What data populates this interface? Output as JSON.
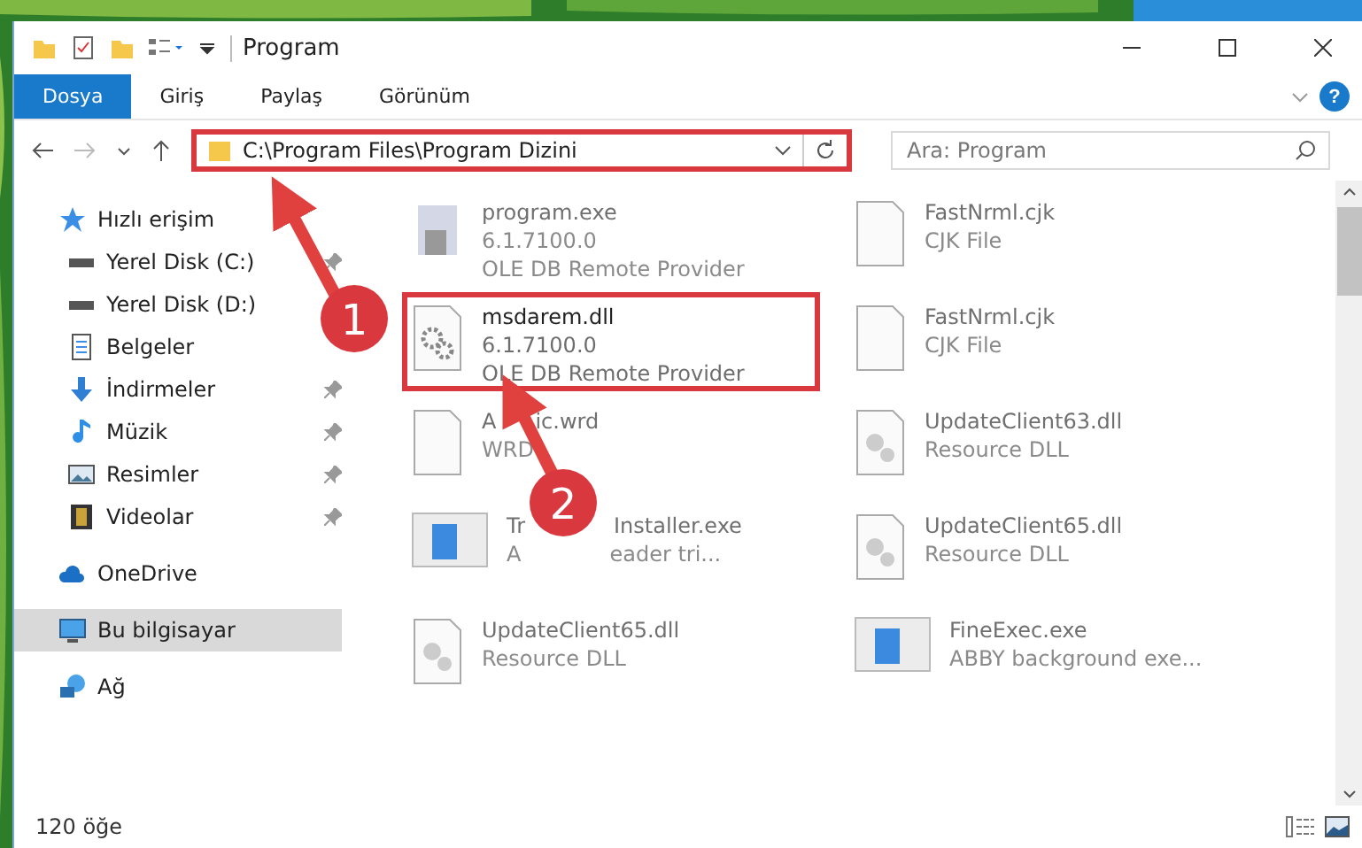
{
  "window": {
    "title": "Program"
  },
  "ribbon_tabs": [
    {
      "label": "Dosya",
      "selected": true
    },
    {
      "label": "Giriş",
      "selected": false
    },
    {
      "label": "Paylaş",
      "selected": false
    },
    {
      "label": "Görünüm",
      "selected": false
    }
  ],
  "help": "?",
  "address": {
    "value": "C:\\Program Files\\Program Dizini",
    "highlighted": true
  },
  "search": {
    "placeholder": "Ara: Program"
  },
  "sidebar": {
    "items": [
      {
        "label": "Hızlı erişim",
        "kind": "star",
        "selected": false,
        "children": [
          {
            "label": "Yerel Disk (C:)",
            "kind": "drive",
            "pinned": true,
            "selected": false
          },
          {
            "label": "Yerel Disk (D:)",
            "kind": "drive",
            "pinned": false,
            "selected": false
          },
          {
            "label": "Belgeler",
            "kind": "document",
            "pinned": false,
            "selected": false
          },
          {
            "label": "İndirmeler",
            "kind": "download",
            "pinned": true,
            "selected": false
          },
          {
            "label": "Müzik",
            "kind": "music",
            "pinned": true,
            "selected": false
          },
          {
            "label": "Resimler",
            "kind": "pictures",
            "pinned": true,
            "selected": false
          },
          {
            "label": "Videolar",
            "kind": "video",
            "pinned": true,
            "selected": false
          }
        ]
      },
      {
        "label": "OneDrive",
        "kind": "cloud",
        "selected": false
      },
      {
        "label": "Bu bilgisayar",
        "kind": "computer",
        "selected": true
      },
      {
        "label": "Ağ",
        "kind": "network",
        "selected": false
      }
    ]
  },
  "files": [
    {
      "name": [
        "program.exe"
      ],
      "lines": [
        [
          "6.1.7100.0"
        ],
        [
          "OLE DB Remote Provider"
        ]
      ],
      "kind": "exe",
      "highlighted": false
    },
    {
      "name": [
        "FastNrml.cjk"
      ],
      "lines": [
        [
          "CJK File"
        ]
      ],
      "kind": "blank",
      "highlighted": false
    },
    {
      "name": [
        "msdarem.dll"
      ],
      "lines": [
        [
          "6.1.7100.0"
        ],
        [
          "OLE DB Remote Provider"
        ]
      ],
      "kind": "dll",
      "highlighted": true
    },
    {
      "name": [
        "FastNrml.cjk"
      ],
      "lines": [
        [
          "CJK File"
        ]
      ],
      "kind": "blank",
      "highlighted": false
    },
    {
      "name": [
        "A",
        "ic.wrd"
      ],
      "lines": [
        [
          "WRD"
        ]
      ],
      "kind": "blank",
      "highlighted": false
    },
    {
      "name": [
        "UpdateClient63.dll"
      ],
      "lines": [
        [
          "Resource DLL"
        ]
      ],
      "kind": "resource",
      "highlighted": false
    },
    {
      "name": [
        "Tr",
        "Installer.exe"
      ],
      "lines": [
        [
          "A",
          "eader tri..."
        ]
      ],
      "kind": "app",
      "highlighted": false
    },
    {
      "name": [
        "UpdateClient65.dll"
      ],
      "lines": [
        [
          "Resource DLL"
        ]
      ],
      "kind": "resource",
      "highlighted": false
    },
    {
      "name": [
        "UpdateClient65.dll"
      ],
      "lines": [
        [
          "Resource DLL"
        ]
      ],
      "kind": "resource",
      "highlighted": false
    },
    {
      "name": [
        "FineExec.exe"
      ],
      "lines": [
        [
          "ABBY background exe..."
        ]
      ],
      "kind": "app",
      "highlighted": false
    }
  ],
  "status_bar": {
    "count": "120 öğe"
  },
  "annotations": [
    {
      "label": "1"
    },
    {
      "label": "2"
    }
  ]
}
